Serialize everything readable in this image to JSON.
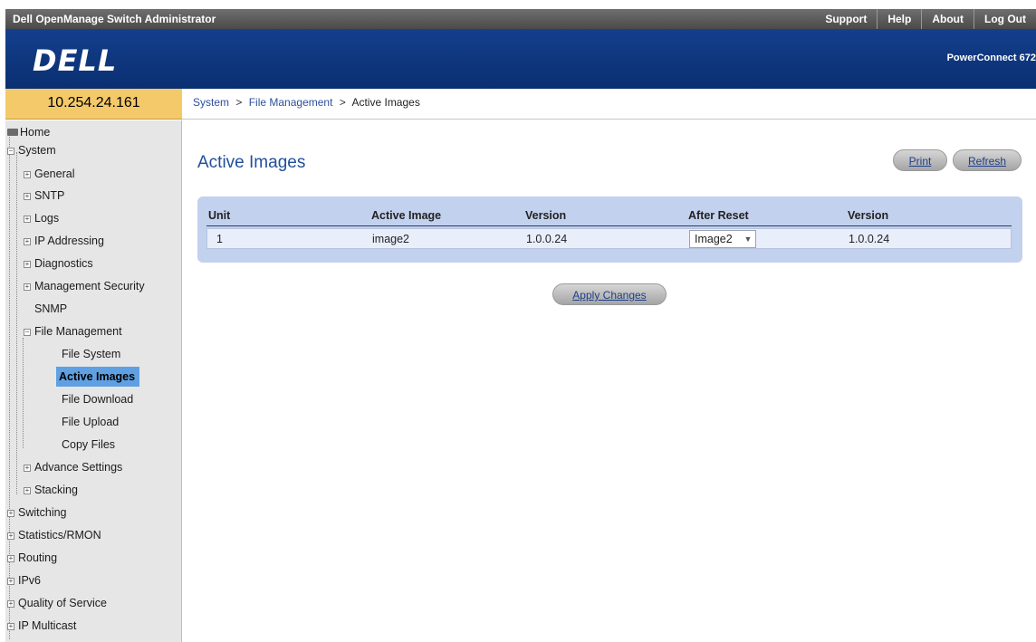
{
  "header": {
    "app_title": "Dell OpenManage Switch Administrator",
    "links": [
      "Support",
      "Help",
      "About",
      "Log Out"
    ],
    "logo_text": "DELL",
    "product": "PowerConnect 672"
  },
  "ip_address": "10.254.24.161",
  "breadcrumb": {
    "items": [
      "System",
      "File Management"
    ],
    "separator": ">",
    "current": "Active Images"
  },
  "sidebar": {
    "home": "Home",
    "system": "System",
    "system_children": [
      "General",
      "SNTP",
      "Logs",
      "IP Addressing",
      "Diagnostics",
      "Management Security"
    ],
    "snmp": "SNMP",
    "file_management": "File Management",
    "file_children": [
      "File System",
      "Active Images",
      "File Download",
      "File Upload",
      "Copy Files"
    ],
    "system_tail": [
      "Advance Settings",
      "Stacking"
    ],
    "top_level": [
      "Switching",
      "Statistics/RMON",
      "Routing",
      "IPv6",
      "Quality of Service",
      "IP Multicast"
    ],
    "selected": "Active Images"
  },
  "main": {
    "title": "Active Images",
    "print_label": "Print",
    "refresh_label": "Refresh",
    "apply_label": "Apply Changes",
    "table": {
      "headers": [
        "Unit",
        "Active Image",
        "Version",
        "After Reset",
        "Version"
      ],
      "rows": [
        {
          "unit": "1",
          "active_image": "image2",
          "version": "1.0.0.24",
          "after_reset": "Image2",
          "reset_version": "1.0.0.24"
        }
      ]
    }
  },
  "colors": {
    "banner": "#0a2f72",
    "ip_box": "#f3c96a",
    "selected_nav": "#5fa0e3",
    "title": "#214f9b",
    "table_bg": "#c2d1ee"
  }
}
